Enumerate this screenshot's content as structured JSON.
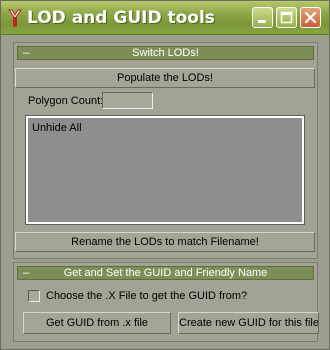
{
  "window": {
    "title": "LOD and GUID tools",
    "icon": "3dsmax-icon",
    "buttons": [
      "minimize",
      "maximize",
      "close"
    ]
  },
  "switch_lods": {
    "header_marker": "–",
    "header": "Switch LODs!",
    "populate_label": "Populate the LODs!",
    "polygon_count_label": "Polygon Count:",
    "polygon_count_value": "",
    "list_items": [
      "Unhide All"
    ],
    "rename_label": "Rename the LODs to match Filename!"
  },
  "guid": {
    "header_marker": "–",
    "header": "Get and Set the GUID and Friendly Name",
    "checkbox_label": "Choose the .X File to get the GUID from?",
    "checkbox_checked": false,
    "get_guid_label": "Get GUID from .x file",
    "create_guid_label": "Create new GUID for this file"
  }
}
